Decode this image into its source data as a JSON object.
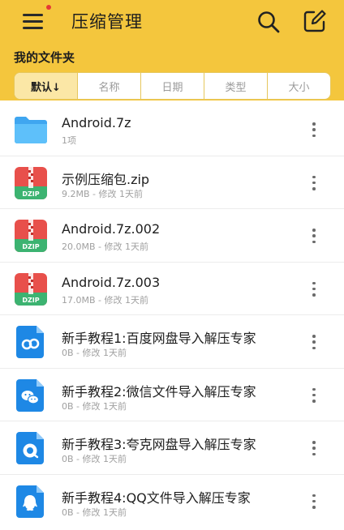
{
  "header": {
    "title": "压缩管理",
    "menu_icon": "hamburger-menu-icon",
    "search_icon": "search-icon",
    "edit_icon": "edit-icon",
    "notification_dot_color": "#e53935",
    "background_color": "#F4C63D"
  },
  "section": {
    "title": "我的文件夹"
  },
  "sort_tabs": [
    {
      "label": "默认↓",
      "active": true
    },
    {
      "label": "名称",
      "active": false
    },
    {
      "label": "日期",
      "active": false
    },
    {
      "label": "类型",
      "active": false
    },
    {
      "label": "大小",
      "active": false
    }
  ],
  "files": [
    {
      "name": "Android.7z",
      "meta": "1项",
      "icon": "folder-icon"
    },
    {
      "name": "示例压缩包.zip",
      "meta": "9.2MB - 修改 1天前",
      "icon": "zip-archive-icon"
    },
    {
      "name": "Android.7z.002",
      "meta": "20.0MB - 修改 1天前",
      "icon": "zip-archive-icon"
    },
    {
      "name": "Android.7z.003",
      "meta": "17.0MB - 修改 1天前",
      "icon": "zip-archive-icon"
    },
    {
      "name": "新手教程1:百度网盘导入解压专家",
      "meta": "0B - 修改 1天前",
      "icon": "baidu-netdisk-doc-icon"
    },
    {
      "name": "新手教程2:微信文件导入解压专家",
      "meta": "0B - 修改 1天前",
      "icon": "wechat-doc-icon"
    },
    {
      "name": "新手教程3:夸克网盘导入解压专家",
      "meta": "0B - 修改 1天前",
      "icon": "quark-doc-icon"
    },
    {
      "name": "新手教程4:QQ文件导入解压专家",
      "meta": "0B - 修改 1天前",
      "icon": "qq-doc-icon"
    }
  ],
  "zip_icon_label": "DZIP",
  "colors": {
    "accent": "#F4C63D",
    "folder": "#4FB3F6",
    "doc_blue": "#1E88E5",
    "zip_red": "#E8504B",
    "zip_green": "#3CB371"
  }
}
